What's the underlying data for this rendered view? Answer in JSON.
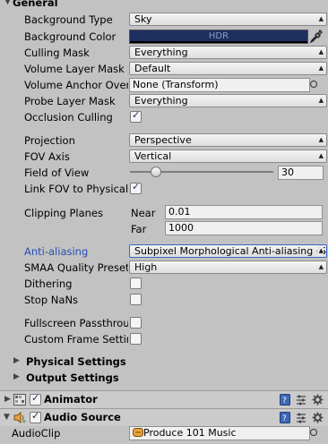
{
  "general": {
    "title": "General",
    "background_type": {
      "label": "Background Type",
      "value": "Sky"
    },
    "background_color": {
      "label": "Background Color",
      "value": "HDR",
      "color": "#1d2f5f"
    },
    "culling_mask": {
      "label": "Culling Mask",
      "value": "Everything"
    },
    "volume_layer_mask": {
      "label": "Volume Layer Mask",
      "value": "Default"
    },
    "volume_anchor": {
      "label": "Volume Anchor Over",
      "value": "None (Transform)"
    },
    "probe_layer_mask": {
      "label": "Probe Layer Mask",
      "value": "Everything"
    },
    "occlusion_culling": {
      "label": "Occlusion Culling",
      "checked": true
    },
    "projection": {
      "label": "Projection",
      "value": "Perspective"
    },
    "fov_axis": {
      "label": "FOV Axis",
      "value": "Vertical"
    },
    "field_of_view": {
      "label": "Field of View",
      "value": "30",
      "slider_fraction": 0.17
    },
    "link_fov": {
      "label": "Link FOV to Physical",
      "checked": true
    },
    "clipping_planes": {
      "label": "Clipping Planes",
      "near_label": "Near",
      "near_value": "0.01",
      "far_label": "Far",
      "far_value": "1000"
    },
    "anti_aliasing": {
      "label": "Anti-aliasing",
      "value": "Subpixel Morphological Anti-aliasing (S"
    },
    "smaa_quality": {
      "label": "SMAA Quality Preset",
      "value": "High"
    },
    "dithering": {
      "label": "Dithering",
      "checked": false
    },
    "stop_nans": {
      "label": "Stop NaNs",
      "checked": false
    },
    "fullscreen_passthrough": {
      "label": "Fullscreen Passthrou",
      "checked": false
    },
    "custom_frame_settings": {
      "label": "Custom Frame Settin",
      "checked": false
    }
  },
  "physical_settings": {
    "title": "Physical Settings"
  },
  "output_settings": {
    "title": "Output Settings"
  },
  "components": {
    "animator": {
      "title": "Animator",
      "enabled": true
    },
    "audio_source": {
      "title": "Audio Source",
      "enabled": true,
      "audio_clip_label": "AudioClip",
      "audio_clip_value": "Produce 101 Music"
    }
  }
}
